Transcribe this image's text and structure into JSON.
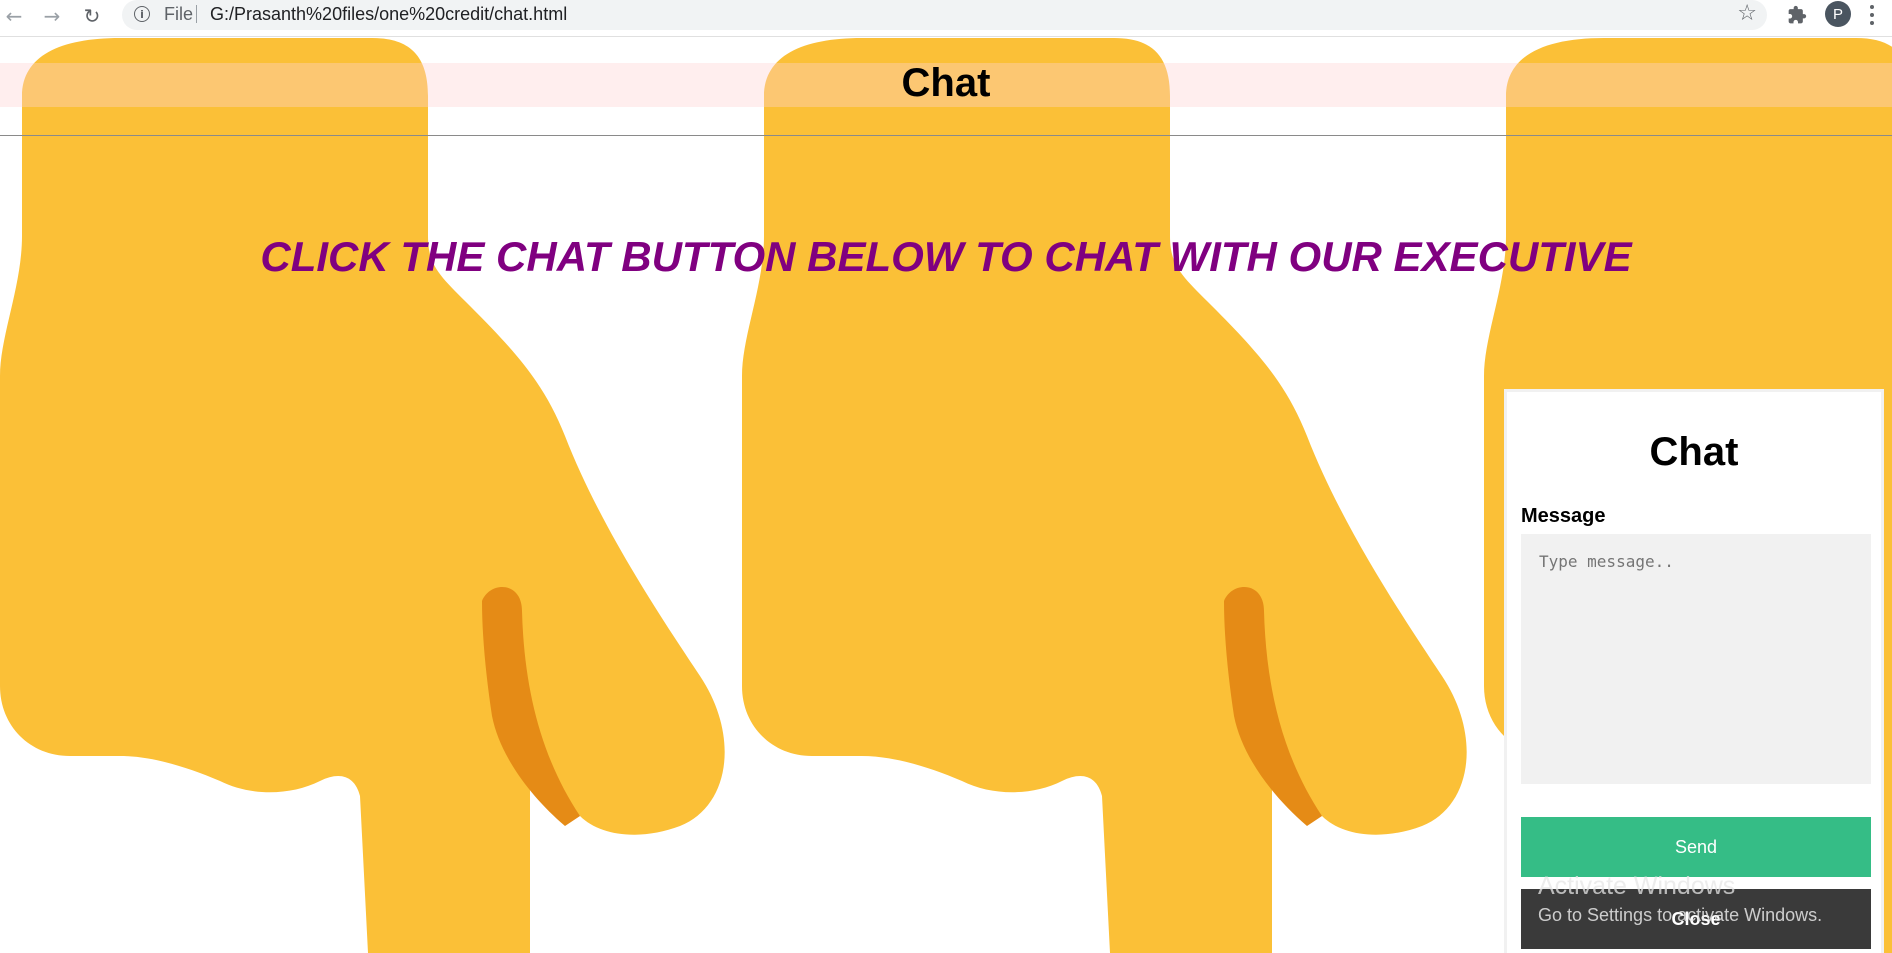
{
  "browser": {
    "back_icon": "back-arrow-icon",
    "forward_icon": "forward-arrow-icon",
    "reload_icon": "reload-icon",
    "scheme_label": "File",
    "url": "G:/Prasanth%20files/one%20credit/chat.html",
    "profile_initial": "P"
  },
  "page": {
    "title": "Chat",
    "cta": "CLICK THE CHAT BUTTON BELOW TO CHAT WITH OUR EXECUTIVE",
    "background": "pointing-down-hand-emoji",
    "hand_color": "#fbc037",
    "shadow_color": "#e58b16",
    "cta_color": "#800080"
  },
  "chat": {
    "title": "Chat",
    "message_label": "Message",
    "message_placeholder": "Type message..",
    "message_value": "",
    "send_label": "Send",
    "close_label": "Close",
    "send_color": "#35bd86",
    "close_color": "#3a3a3a"
  },
  "watermark": {
    "title": "Activate Windows",
    "subtitle": "Go to Settings to activate Windows."
  }
}
